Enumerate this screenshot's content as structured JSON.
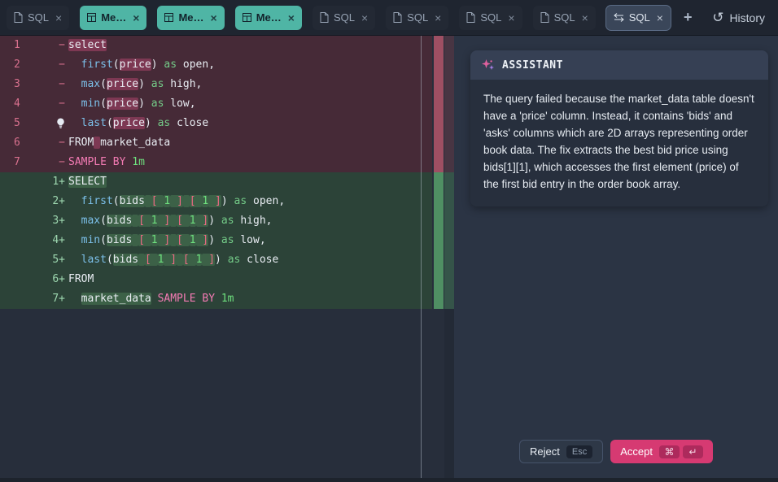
{
  "colors": {
    "accent_teal": "#4fb5a5",
    "accent_pink": "#d63a72",
    "diff_removed": "#9e4f63",
    "diff_added": "#4f8f63"
  },
  "tabbar": {
    "tabs": [
      {
        "label": "SQL",
        "icon": "file-icon",
        "type": "inactive"
      },
      {
        "label": "Me…",
        "icon": "table-icon",
        "type": "teal"
      },
      {
        "label": "Me…",
        "icon": "table-icon",
        "type": "teal"
      },
      {
        "label": "Me…",
        "icon": "table-icon",
        "type": "teal"
      },
      {
        "label": "SQL",
        "icon": "file-icon",
        "type": "inactive"
      },
      {
        "label": "SQL",
        "icon": "file-icon",
        "type": "inactive"
      },
      {
        "label": "SQL",
        "icon": "file-icon",
        "type": "inactive"
      },
      {
        "label": "SQL",
        "icon": "file-icon",
        "type": "inactive"
      },
      {
        "label": "SQL",
        "icon": "compare-icon",
        "type": "active"
      }
    ],
    "close_label": "×",
    "add_label": "+",
    "history_label": "History",
    "history_icon": "↺"
  },
  "editor": {
    "deleted_lines": [
      {
        "left": "1",
        "right": "−",
        "tokens": [
          {
            "t": "select",
            "c": "plain",
            "e": true
          }
        ]
      },
      {
        "left": "2",
        "right": "−",
        "tokens": [
          {
            "t": "  ",
            "c": "plain"
          },
          {
            "t": "first",
            "c": "fn"
          },
          {
            "t": "(",
            "c": "plain"
          },
          {
            "t": "price",
            "c": "plain",
            "e": true
          },
          {
            "t": ")",
            "c": "plain"
          },
          {
            "t": " ",
            "c": "plain"
          },
          {
            "t": "as",
            "c": "kw2"
          },
          {
            "t": " open,",
            "c": "plain"
          }
        ]
      },
      {
        "left": "3",
        "right": "−",
        "tokens": [
          {
            "t": "  ",
            "c": "plain"
          },
          {
            "t": "max",
            "c": "fn"
          },
          {
            "t": "(",
            "c": "plain"
          },
          {
            "t": "price",
            "c": "plain",
            "e": true
          },
          {
            "t": ")",
            "c": "plain"
          },
          {
            "t": " ",
            "c": "plain"
          },
          {
            "t": "as",
            "c": "kw2"
          },
          {
            "t": " high,",
            "c": "plain"
          }
        ]
      },
      {
        "left": "4",
        "right": "−",
        "tokens": [
          {
            "t": "  ",
            "c": "plain"
          },
          {
            "t": "min",
            "c": "fn"
          },
          {
            "t": "(",
            "c": "plain"
          },
          {
            "t": "price",
            "c": "plain",
            "e": true
          },
          {
            "t": ")",
            "c": "plain"
          },
          {
            "t": " ",
            "c": "plain"
          },
          {
            "t": "as",
            "c": "kw2"
          },
          {
            "t": " low,",
            "c": "plain"
          }
        ]
      },
      {
        "left": "5",
        "right": "−",
        "bulb": true,
        "tokens": [
          {
            "t": "  ",
            "c": "plain"
          },
          {
            "t": "last",
            "c": "fn"
          },
          {
            "t": "(",
            "c": "plain"
          },
          {
            "t": "price",
            "c": "plain",
            "e": true
          },
          {
            "t": ")",
            "c": "plain"
          },
          {
            "t": " ",
            "c": "plain"
          },
          {
            "t": "as",
            "c": "kw2"
          },
          {
            "t": " close",
            "c": "plain"
          }
        ]
      },
      {
        "left": "6",
        "right": "−",
        "tokens": [
          {
            "t": "FROM",
            "c": "plain"
          },
          {
            "t": " ",
            "c": "plain",
            "e": true
          },
          {
            "t": "market_data",
            "c": "plain"
          }
        ]
      },
      {
        "left": "7",
        "right": "−",
        "tokens": [
          {
            "t": "SAMPLE BY",
            "c": "kw"
          },
          {
            "t": " ",
            "c": "plain"
          },
          {
            "t": "1m",
            "c": "num"
          }
        ]
      }
    ],
    "added_lines": [
      {
        "left": "",
        "right": "1+",
        "tokens": [
          {
            "t": "SELECT",
            "c": "plain",
            "e": true
          }
        ]
      },
      {
        "left": "",
        "right": "2+",
        "tokens": [
          {
            "t": "  ",
            "c": "plain"
          },
          {
            "t": "first",
            "c": "fn"
          },
          {
            "t": "(",
            "c": "plain"
          },
          {
            "t": "bids",
            "c": "plain",
            "e": true
          },
          {
            "t": " ",
            "c": "plain",
            "e": true
          },
          {
            "t": "[ ",
            "c": "br",
            "e": true
          },
          {
            "t": "1",
            "c": "num",
            "e": true
          },
          {
            "t": " ]",
            "c": "br",
            "e": true
          },
          {
            "t": " ",
            "c": "plain",
            "e": true
          },
          {
            "t": "[ ",
            "c": "br",
            "e": true
          },
          {
            "t": "1",
            "c": "num",
            "e": true
          },
          {
            "t": " ]",
            "c": "br",
            "e": true
          },
          {
            "t": ")",
            "c": "plain"
          },
          {
            "t": " ",
            "c": "plain"
          },
          {
            "t": "as",
            "c": "kw2"
          },
          {
            "t": " open,",
            "c": "plain"
          }
        ]
      },
      {
        "left": "",
        "right": "3+",
        "tokens": [
          {
            "t": "  ",
            "c": "plain"
          },
          {
            "t": "max",
            "c": "fn"
          },
          {
            "t": "(",
            "c": "plain"
          },
          {
            "t": "bids",
            "c": "plain",
            "e": true
          },
          {
            "t": " ",
            "c": "plain",
            "e": true
          },
          {
            "t": "[ ",
            "c": "br",
            "e": true
          },
          {
            "t": "1",
            "c": "num",
            "e": true
          },
          {
            "t": " ]",
            "c": "br",
            "e": true
          },
          {
            "t": " ",
            "c": "plain",
            "e": true
          },
          {
            "t": "[ ",
            "c": "br",
            "e": true
          },
          {
            "t": "1",
            "c": "num",
            "e": true
          },
          {
            "t": " ]",
            "c": "br",
            "e": true
          },
          {
            "t": ")",
            "c": "plain"
          },
          {
            "t": " ",
            "c": "plain"
          },
          {
            "t": "as",
            "c": "kw2"
          },
          {
            "t": " high,",
            "c": "plain"
          }
        ]
      },
      {
        "left": "",
        "right": "4+",
        "tokens": [
          {
            "t": "  ",
            "c": "plain"
          },
          {
            "t": "min",
            "c": "fn"
          },
          {
            "t": "(",
            "c": "plain"
          },
          {
            "t": "bids",
            "c": "plain",
            "e": true
          },
          {
            "t": " ",
            "c": "plain",
            "e": true
          },
          {
            "t": "[ ",
            "c": "br",
            "e": true
          },
          {
            "t": "1",
            "c": "num",
            "e": true
          },
          {
            "t": " ]",
            "c": "br",
            "e": true
          },
          {
            "t": " ",
            "c": "plain",
            "e": true
          },
          {
            "t": "[ ",
            "c": "br",
            "e": true
          },
          {
            "t": "1",
            "c": "num",
            "e": true
          },
          {
            "t": " ]",
            "c": "br",
            "e": true
          },
          {
            "t": ")",
            "c": "plain"
          },
          {
            "t": " ",
            "c": "plain"
          },
          {
            "t": "as",
            "c": "kw2"
          },
          {
            "t": " low,",
            "c": "plain"
          }
        ]
      },
      {
        "left": "",
        "right": "5+",
        "tokens": [
          {
            "t": "  ",
            "c": "plain"
          },
          {
            "t": "last",
            "c": "fn"
          },
          {
            "t": "(",
            "c": "plain"
          },
          {
            "t": "bids",
            "c": "plain",
            "e": true
          },
          {
            "t": " ",
            "c": "plain",
            "e": true
          },
          {
            "t": "[ ",
            "c": "br",
            "e": true
          },
          {
            "t": "1",
            "c": "num",
            "e": true
          },
          {
            "t": " ]",
            "c": "br",
            "e": true
          },
          {
            "t": " ",
            "c": "plain",
            "e": true
          },
          {
            "t": "[ ",
            "c": "br",
            "e": true
          },
          {
            "t": "1",
            "c": "num",
            "e": true
          },
          {
            "t": " ]",
            "c": "br",
            "e": true
          },
          {
            "t": ")",
            "c": "plain"
          },
          {
            "t": " ",
            "c": "plain"
          },
          {
            "t": "as",
            "c": "kw2"
          },
          {
            "t": " close",
            "c": "plain"
          }
        ]
      },
      {
        "left": "",
        "right": "6+",
        "tokens": [
          {
            "t": "FROM",
            "c": "plain"
          }
        ]
      },
      {
        "left": "",
        "right": "7+",
        "tokens": [
          {
            "t": "  ",
            "c": "plain"
          },
          {
            "t": "market_data",
            "c": "plain",
            "e": true
          },
          {
            "t": " ",
            "c": "plain"
          },
          {
            "t": "SAMPLE BY",
            "c": "kw"
          },
          {
            "t": " ",
            "c": "plain"
          },
          {
            "t": "1m",
            "c": "num"
          }
        ]
      }
    ]
  },
  "assistant": {
    "title": "ASSISTANT",
    "message": "The query failed because the market_data table doesn't have a 'price' column. Instead, it contains 'bids' and 'asks' columns which are 2D arrays representing order book data. The fix extracts the best bid price using bids[1][1], which accesses the first element (price) of the first bid entry in the order book array.",
    "reject_label": "Reject",
    "reject_shortcut": "Esc",
    "accept_label": "Accept",
    "accept_shortcuts": [
      "⌘",
      "↵"
    ]
  }
}
